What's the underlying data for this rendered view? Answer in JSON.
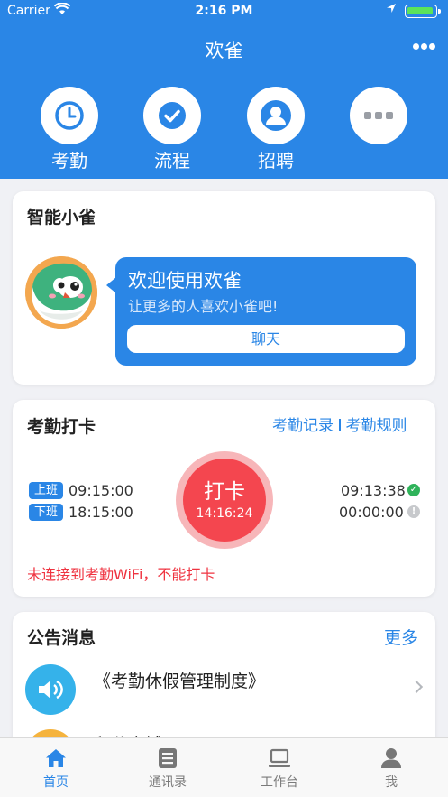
{
  "status_bar": {
    "carrier": "Carrier",
    "time": "2:16 PM"
  },
  "header": {
    "title": "欢雀"
  },
  "quick_actions": [
    {
      "label": "考勤",
      "icon": "clock-icon"
    },
    {
      "label": "流程",
      "icon": "check-icon"
    },
    {
      "label": "招聘",
      "icon": "person-icon"
    },
    {
      "label": "",
      "icon": "more-icon"
    }
  ],
  "assistant": {
    "title": "智能小雀",
    "greeting": "欢迎使用欢雀",
    "subtitle": "让更多的人喜欢小雀吧!",
    "chat_label": "聊天"
  },
  "attendance": {
    "title": "考勤打卡",
    "records_link": "考勤记录",
    "rules_link": "考勤规则",
    "on_tag": "上班",
    "on_time": "09:15:00",
    "off_tag": "下班",
    "off_time": "18:15:00",
    "punch_label": "打卡",
    "punch_time": "14:16:24",
    "checkin_time": "09:13:38",
    "checkout_time": "00:00:00",
    "warning": "未连接到考勤WiFi，不能打卡"
  },
  "notices": {
    "title": "公告消息",
    "more_label": "更多",
    "items": [
      {
        "title": "《考勤休假管理制度》"
      },
      {
        "title": "积分商城"
      }
    ]
  },
  "tabs": [
    {
      "label": "首页",
      "active": true
    },
    {
      "label": "通讯录"
    },
    {
      "label": "工作台"
    },
    {
      "label": "我"
    }
  ],
  "colors": {
    "primary": "#2a86e6",
    "punch": "#f4464f",
    "warning": "#ef3340"
  }
}
